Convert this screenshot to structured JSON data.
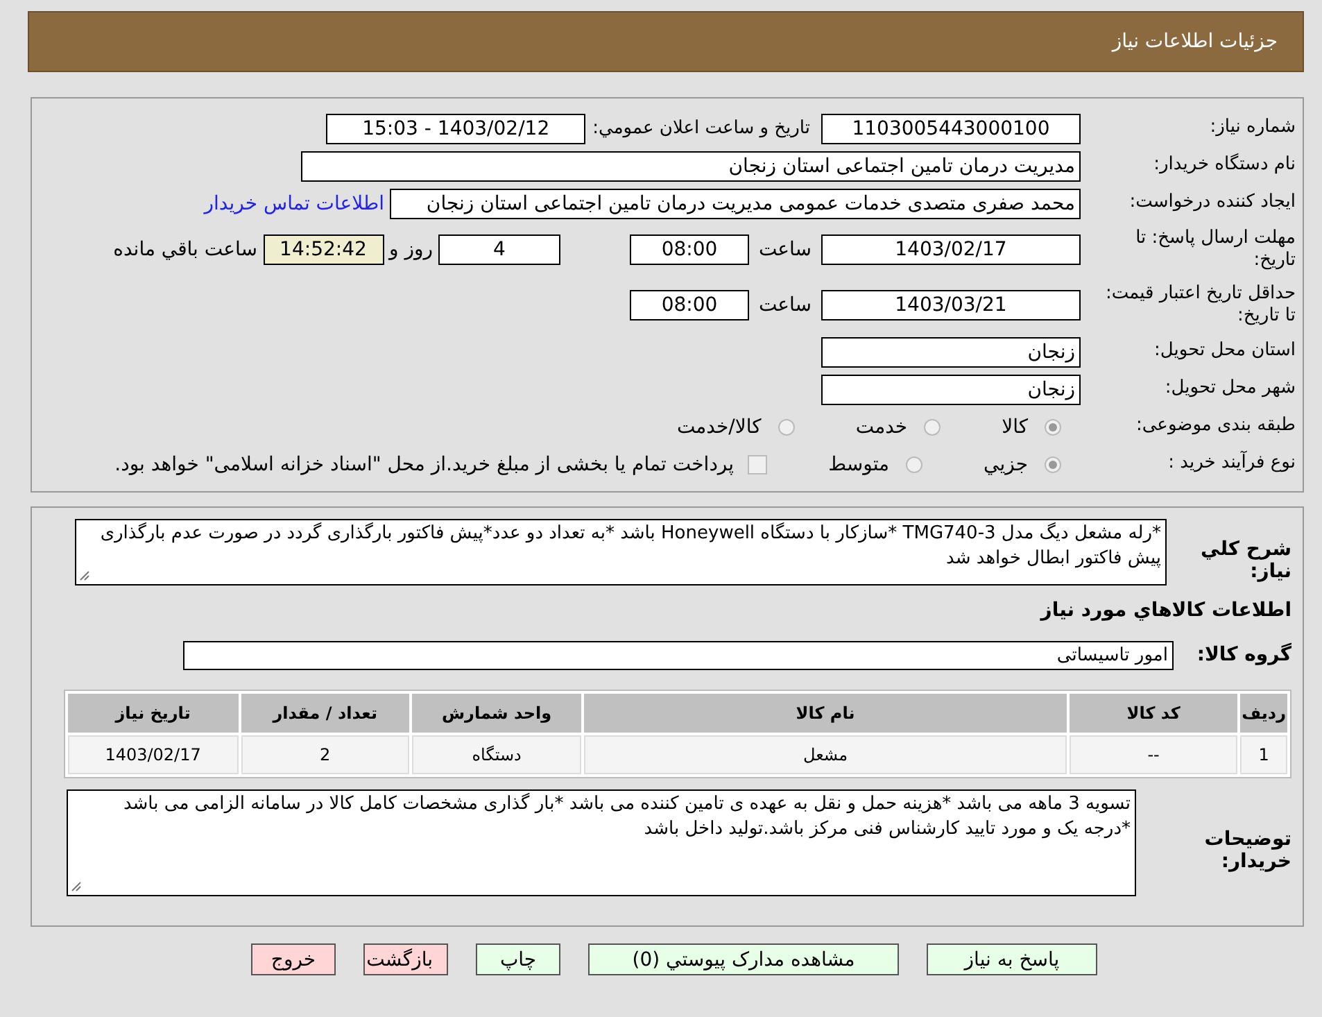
{
  "header": {
    "title": "جزئیات اطلاعات نیاز"
  },
  "need_number": {
    "label": "شماره نیاز:",
    "value": "1103005443000100"
  },
  "announce": {
    "label": "تاریخ و ساعت اعلان عمومي:",
    "value": "1403/02/12 - 15:03"
  },
  "buyer": {
    "label": "نام دستگاه خریدار:",
    "value": "مدیریت درمان تامین اجتماعی استان زنجان"
  },
  "creator": {
    "label": "ایجاد کننده درخواست:",
    "value": "محمد صفری متصدی خدمات عمومی مدیریت درمان تامین اجتماعی استان زنجان",
    "link": "اطلاعات تماس خریدار"
  },
  "deadline": {
    "label": "مهلت ارسال پاسخ: تا تاریخ:",
    "date": "1403/02/17",
    "time_label": "ساعت",
    "time": "08:00",
    "days": "4",
    "days_label": "روز و",
    "remaining": "14:52:42",
    "remaining_label": "ساعت باقي مانده"
  },
  "validity": {
    "label": "حداقل تاریخ اعتبار قیمت: تا تاریخ:",
    "date": "1403/03/21",
    "time_label": "ساعت",
    "time": "08:00"
  },
  "province": {
    "label": "استان محل تحویل:",
    "value": "زنجان"
  },
  "city": {
    "label": "شهر محل تحویل:",
    "value": "زنجان"
  },
  "category": {
    "label": "طبقه بندی موضوعی:",
    "options": [
      {
        "label": "کالا",
        "selected": true
      },
      {
        "label": "خدمت",
        "selected": false
      },
      {
        "label": "کالا/خدمت",
        "selected": false
      }
    ]
  },
  "process": {
    "label": "نوع فرآیند خرید :",
    "options": [
      {
        "label": "جزيي",
        "selected": true
      },
      {
        "label": "متوسط",
        "selected": false
      }
    ],
    "treasury": {
      "checked": false,
      "text": "پرداخت تمام یا بخشی از مبلغ خرید.از محل \"اسناد خزانه اسلامی\" خواهد بود."
    }
  },
  "description": {
    "label": "شرح کلي نیاز:",
    "text": "*رله مشعل دیگ مدل TMG740-3 *سازکار با دستگاه  Honeywell باشد *به تعداد دو عدد*پیش فاکتور بارگذاری گردد در صورت عدم بارگذاری پیش فاکتور ابطال خواهد شد"
  },
  "goods_heading": "اطلاعات کالاهاي مورد نياز",
  "goods_group": {
    "label": "گروه کالا:",
    "value": "امور تاسیساتی"
  },
  "table": {
    "columns": [
      "ردیف",
      "کد کالا",
      "نام کالا",
      "واحد شمارش",
      "تعداد / مقدار",
      "تاریخ نیاز"
    ],
    "rows": [
      [
        "1",
        "--",
        "مشعل",
        "دستگاه",
        "2",
        "1403/02/17"
      ]
    ]
  },
  "buyer_notes": {
    "label": "توضیحات خریدار:",
    "text": "تسویه 3 ماهه می باشد *هزینه حمل و نقل به عهده ی تامین کننده می باشد *بار گذاری  مشخصات کامل کالا در سامانه الزامی می باشد *درجه یک و مورد تایید کارشناس فنی مرکز باشد.تولید داخل باشد"
  },
  "buttons": [
    {
      "label": "پاسخ به نیاز",
      "kind": "action"
    },
    {
      "label": "مشاهده مدارک پیوستي (0)",
      "kind": "action"
    },
    {
      "label": "چاپ",
      "kind": "action"
    },
    {
      "label": "بازگشت",
      "kind": "danger"
    },
    {
      "label": "خروج",
      "kind": "danger"
    }
  ]
}
